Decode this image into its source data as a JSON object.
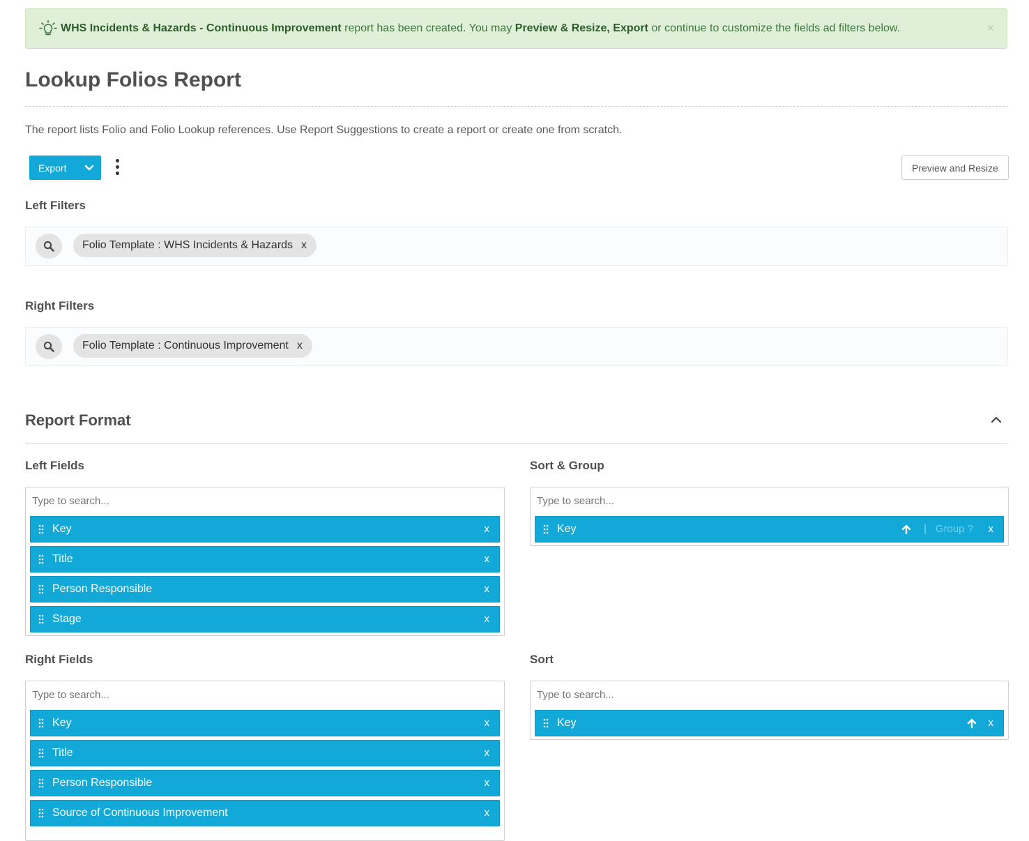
{
  "alert": {
    "report_name": "WHS Incidents & Hazards - Continuous Improvement",
    "text_mid": " report has been created. You may ",
    "actions": "Preview & Resize, Export",
    "text_end": " or continue to customize the fields ad filters below.",
    "close": "×"
  },
  "page": {
    "title": "Lookup Folios Report",
    "description": "The report lists Folio and Folio Lookup references. Use Report Suggestions to create a report or create one from scratch."
  },
  "toolbar": {
    "export_label": "Export",
    "preview_label": "Preview and Resize"
  },
  "left_filters": {
    "label": "Left Filters",
    "chip": "Folio Template : WHS Incidents & Hazards",
    "remove": "x"
  },
  "right_filters": {
    "label": "Right Filters",
    "chip": "Folio Template : Continuous Improvement",
    "remove": "x"
  },
  "report_format": {
    "title": "Report Format",
    "placeholder": "Type to search...",
    "remove": "x",
    "group_label": "Group ?",
    "separator": "|",
    "left_fields": {
      "label": "Left Fields",
      "items": [
        "Key",
        "Title",
        "Person Responsible",
        "Stage"
      ]
    },
    "sort_group": {
      "label": "Sort & Group",
      "items": [
        "Key"
      ]
    },
    "right_fields": {
      "label": "Right Fields",
      "items": [
        "Key",
        "Title",
        "Person Responsible",
        "Source of Continuous Improvement"
      ]
    },
    "sort": {
      "label": "Sort",
      "items": [
        "Key"
      ]
    }
  },
  "colors": {
    "accent": "#12a9d8",
    "alert_bg": "#e0f0d8",
    "alert_text": "#3c763d"
  }
}
